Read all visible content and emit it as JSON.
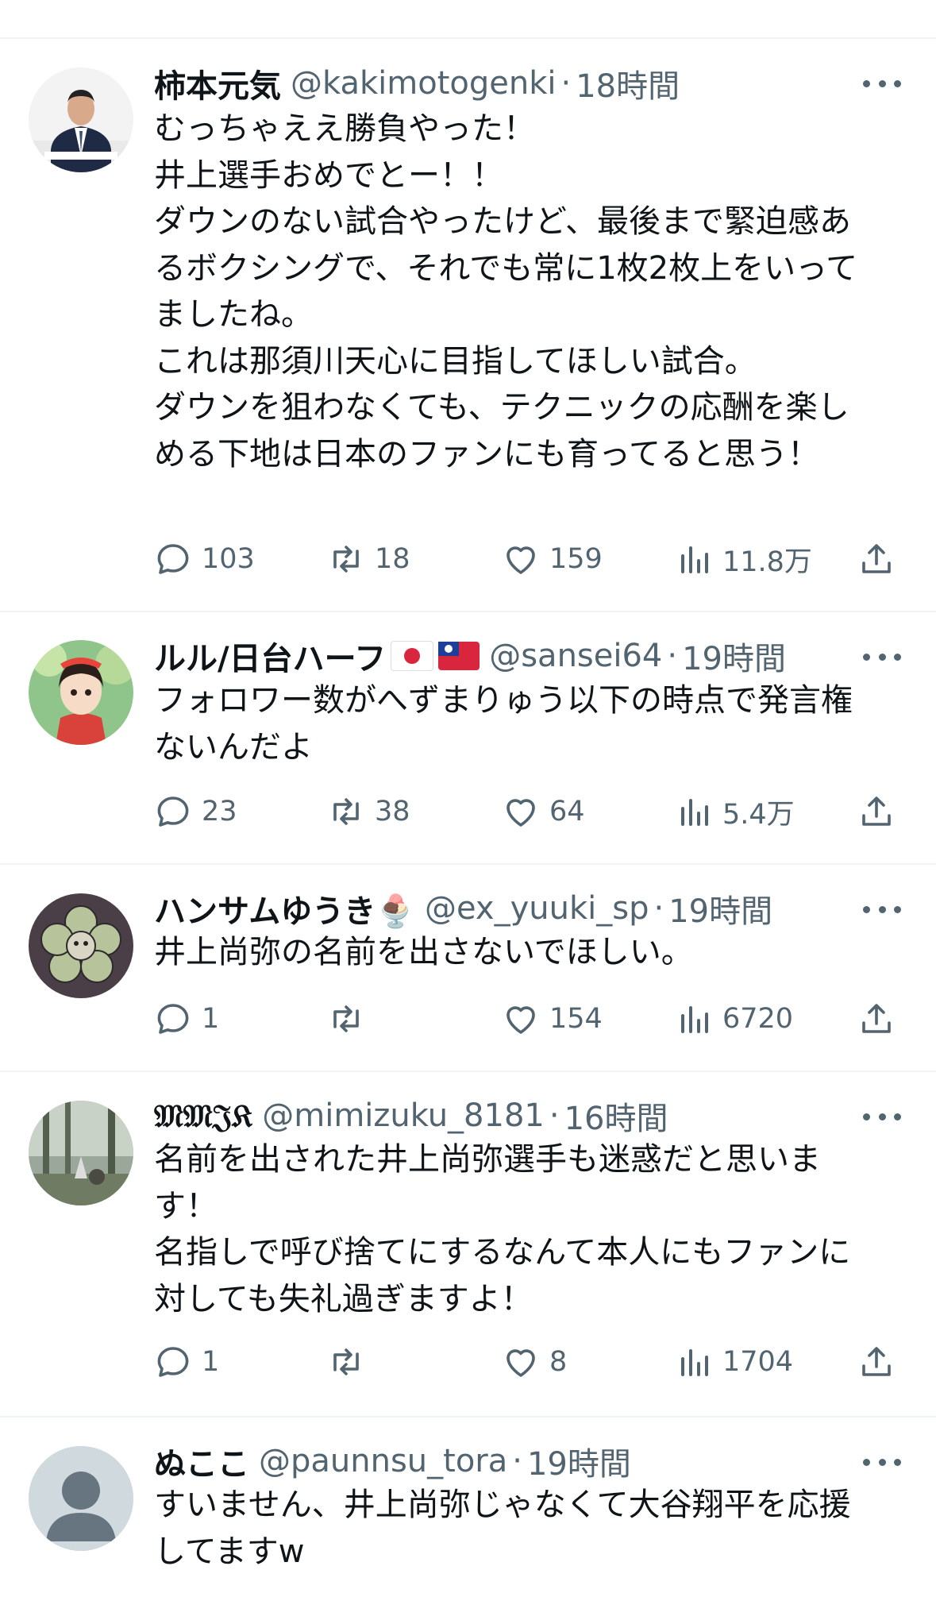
{
  "tweets": [
    {
      "name": "柿本元気",
      "handle": "@kakimotogenki",
      "separator": "·",
      "time": "18時間",
      "lines": [
        "むっちゃええ勝負やった！",
        "井上選手おめでとー！！",
        "ダウンのない試合やったけど、最後まで緊迫感あ",
        "るボクシングで、それでも常に1枚2枚上をいって",
        "ましたね。",
        "",
        "これは那須川天心に目指してほしい試合。",
        "ダウンを狙わなくても、テクニックの応酬を楽し",
        "める下地は日本のファンにも育ってると思う！"
      ],
      "replies": "103",
      "retweets": "18",
      "likes": "159",
      "views": "11.8万"
    },
    {
      "name": "ルル/日台ハーフ",
      "flags": [
        "japan-flag",
        "taiwan-flag"
      ],
      "handle": "@sansei64",
      "separator": "·",
      "time": "19時間",
      "lines": [
        "フォロワー数がへずまりゅう以下の時点で発言権",
        "ないんだよ"
      ],
      "replies": "23",
      "retweets": "38",
      "likes": "64",
      "views": "5.4万"
    },
    {
      "name": "ハンサムゆうき🍨",
      "handle": "@ex_yuuki_sp",
      "separator": "·",
      "time": "19時間",
      "lines": [
        "井上尚弥の名前を出さないでほしい。"
      ],
      "replies": "1",
      "retweets": "",
      "likes": "154",
      "views": "6720"
    },
    {
      "name": "𝔐𝔐𝔍𝔎",
      "handle": "@mimizuku_8181",
      "separator": "·",
      "time": "16時間",
      "lines": [
        "名前を出された井上尚弥選手も迷惑だと思いま",
        "す！",
        "名指しで呼び捨てにするなんて本人にもファンに",
        "対しても失礼過ぎますよ！"
      ],
      "replies": "1",
      "retweets": "",
      "likes": "8",
      "views": "1704"
    },
    {
      "name": "ぬここ",
      "handle": "@paunnsu_tora",
      "separator": "·",
      "time": "19時間",
      "lines": [
        "すいません、井上尚弥じゃなくて大谷翔平を応援",
        "してますw"
      ]
    }
  ],
  "icons": {
    "reply": "reply-icon",
    "retweet": "retweet-icon",
    "like": "heart-icon",
    "views": "views-icon",
    "share": "share-icon",
    "more": "more-icon"
  },
  "colors": {
    "text": "#0f1419",
    "secondary": "#536471",
    "divider": "#eff3f4",
    "background": "#ffffff"
  }
}
